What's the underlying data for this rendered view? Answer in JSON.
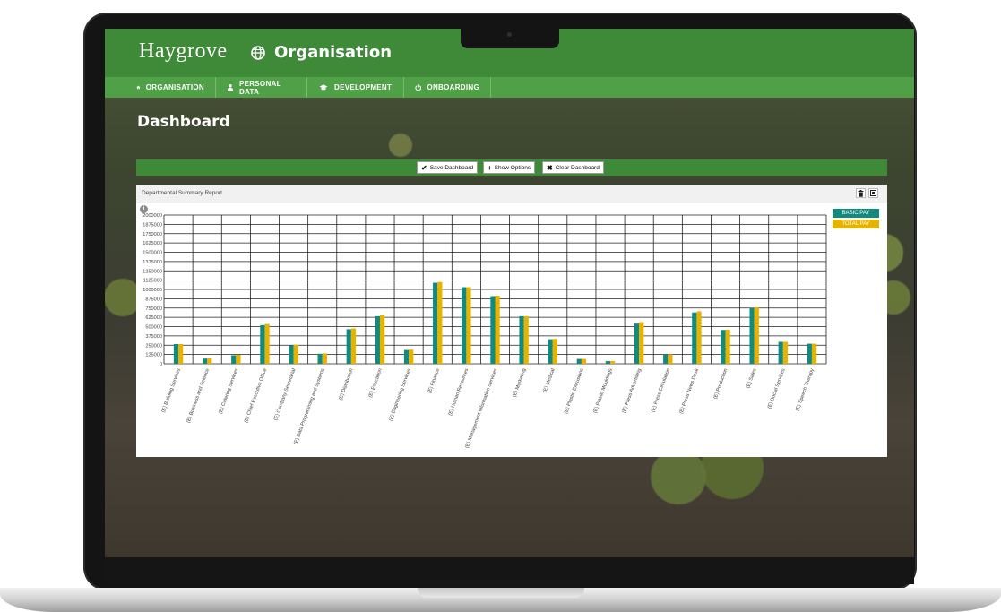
{
  "app": {
    "logo_text": "Haygrove",
    "title": "Organisation",
    "title_icon": "globe-icon"
  },
  "nav": {
    "items": [
      {
        "label": "ORGANISATION",
        "icon": "home-icon"
      },
      {
        "label": "PERSONAL DATA",
        "icon": "user-icon"
      },
      {
        "label": "DEVELOPMENT",
        "icon": "graduation-cap-icon"
      },
      {
        "label": "ONBOARDING",
        "icon": "power-icon"
      }
    ]
  },
  "page": {
    "title": "Dashboard"
  },
  "toolbar": {
    "save_label": "Save Dashboard",
    "options_label": "Show Options",
    "clear_label": "Clear Dashboard"
  },
  "panel": {
    "title": "Departmental Summary Report",
    "info_badge": "i"
  },
  "colors": {
    "brand_green": "#3f8a38",
    "nav_green": "#4fa046",
    "basic_pay": "#138a7e",
    "total_pay": "#e5b300"
  },
  "chart_data": {
    "type": "bar",
    "ylim": [
      0,
      2000000
    ],
    "yticks": [
      "0",
      "125000",
      "250000",
      "375000",
      "500000",
      "625000",
      "750000",
      "875000",
      "1000000",
      "1125000",
      "1250000",
      "1375000",
      "1500000",
      "1625000",
      "1750000",
      "1875000",
      "2000000"
    ],
    "legend_position": "top-right",
    "grid": true,
    "categories": [
      "(E) Building Services",
      "(E) Business and Science",
      "(E) Catering Services",
      "(E) Chief Executive Office",
      "(E) Company Secretarial",
      "(E) Data Programming and Systems",
      "(E) Distribution",
      "(E) Education",
      "(E) Engineering Services",
      "(E) Finance",
      "(E) Human Resources",
      "(E) Management Information Services",
      "(E) Marketing",
      "(E) Medical",
      "(E) Plastic Extrusions",
      "(E) Plastic Mouldings",
      "(E) Press Advertising",
      "(E) Press Circulation",
      "(E) Press News Desk",
      "(E) Production",
      "(E) Sales",
      "(E) Social Services",
      "(E) Speech Therapy"
    ],
    "series": [
      {
        "name": "BASIC PAY",
        "values": [
          265000,
          70000,
          115000,
          520000,
          245000,
          135000,
          465000,
          640000,
          185000,
          1090000,
          1030000,
          910000,
          640000,
          330000,
          65000,
          35000,
          540000,
          120000,
          690000,
          455000,
          750000,
          295000,
          270000
        ]
      },
      {
        "name": "TOTAL PAY",
        "values": [
          265000,
          75000,
          120000,
          535000,
          255000,
          140000,
          475000,
          655000,
          190000,
          1100000,
          1030000,
          915000,
          640000,
          335000,
          65000,
          35000,
          560000,
          125000,
          705000,
          460000,
          760000,
          295000,
          270000
        ]
      }
    ]
  }
}
